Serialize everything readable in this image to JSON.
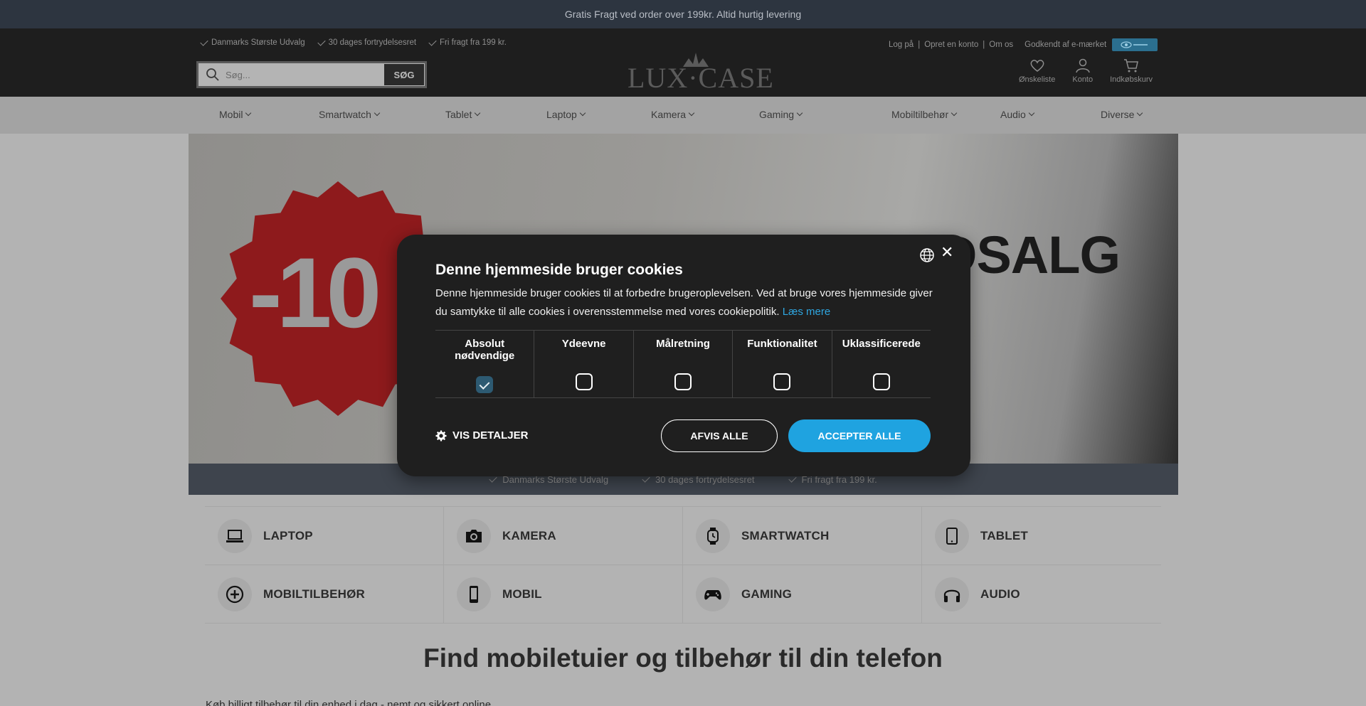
{
  "topbar": {
    "text": "Gratis Fragt ved order over 199kr. Altid hurtig levering"
  },
  "header": {
    "usps": [
      "Danmarks Største Udvalg",
      "30 dages fortrydelsesret",
      "Fri fragt fra 199 kr."
    ],
    "links": {
      "login": "Log på",
      "register": "Opret en konto",
      "about": "Om os",
      "emark": "Godkendt af e-mærket"
    },
    "search": {
      "placeholder": "Søg...",
      "button": "SØG"
    },
    "logo": "LUX·CASE",
    "icons": {
      "wishlist": "Ønskeliste",
      "account": "Konto",
      "cart": "Indkøbskurv"
    }
  },
  "nav": [
    "Mobil",
    "Smartwatch",
    "Tablet",
    "Laptop",
    "Kamera",
    "Gaming",
    "Mobiltilbehør",
    "Audio",
    "Diverse"
  ],
  "hero": {
    "badge": "-10",
    "headline": "DSALG",
    "usps": [
      "Danmarks Største Udvalg",
      "30 dages fortrydelsesret",
      "Fri fragt fra 199 kr."
    ]
  },
  "categories": [
    {
      "label": "LAPTOP",
      "icon": "laptop-icon"
    },
    {
      "label": "KAMERA",
      "icon": "camera-icon"
    },
    {
      "label": "SMARTWATCH",
      "icon": "smartwatch-icon"
    },
    {
      "label": "TABLET",
      "icon": "tablet-icon"
    },
    {
      "label": "MOBILTILBEHØR",
      "icon": "plus-circle-icon"
    },
    {
      "label": "MOBIL",
      "icon": "phone-icon"
    },
    {
      "label": "GAMING",
      "icon": "gamepad-icon"
    },
    {
      "label": "AUDIO",
      "icon": "headphones-icon"
    }
  ],
  "main": {
    "heading": "Find mobiletuier og tilbehør til din telefon",
    "intro": "Køb billigt tilbehør til din enhed i dag - nemt og sikkert online."
  },
  "cookie": {
    "title": "Denne hjemmeside bruger cookies",
    "body": "Denne hjemmeside bruger cookies til at forbedre brugeroplevelsen. Ved at bruge vores hjemmeside giver du samtykke til alle cookies i overensstemmelse med vores cookiepolitik.",
    "read_more": "Læs mere",
    "categories": [
      {
        "label": "Absolut nødvendige",
        "checked": true
      },
      {
        "label": "Ydeevne",
        "checked": false
      },
      {
        "label": "Målretning",
        "checked": false
      },
      {
        "label": "Funktionalitet",
        "checked": false
      },
      {
        "label": "Uklassificerede",
        "checked": false
      }
    ],
    "details": "VIS DETALJER",
    "reject": "AFVIS ALLE",
    "accept": "ACCEPTER ALLE"
  },
  "colors": {
    "accent": "#1fa3e0",
    "badge_red": "#8e1a1c",
    "header_bg": "#1e1e1e"
  }
}
